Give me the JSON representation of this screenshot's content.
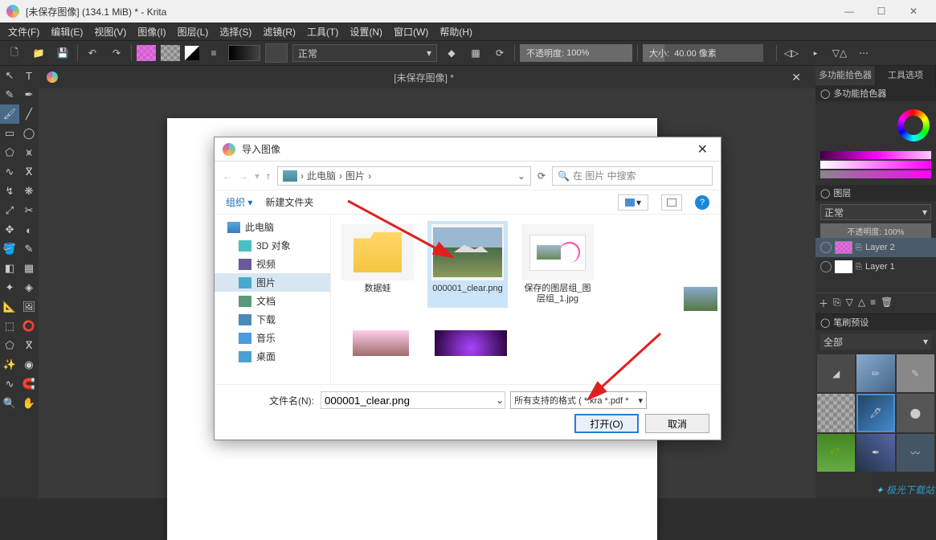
{
  "window": {
    "title": "[未保存图像]  (134.1 MiB)  * - Krita"
  },
  "menu": {
    "file": "文件(F)",
    "edit": "编辑(E)",
    "view": "视图(V)",
    "image": "图像(I)",
    "layer": "图层(L)",
    "select": "选择(S)",
    "filter": "滤镜(R)",
    "tools": "工具(T)",
    "settings": "设置(N)",
    "window": "窗口(W)",
    "help": "帮助(H)"
  },
  "toolbar": {
    "blend_mode": "正常",
    "opacity_label": "不透明度:",
    "opacity_value": "100%",
    "size_label": "大小:",
    "size_value": "40.00 像素"
  },
  "document": {
    "tab_title": "[未保存图像]  *"
  },
  "right": {
    "tab_color_picker": "多功能拾色器",
    "tab_tool_options": "工具选项",
    "header_picker": "多功能拾色器",
    "header_layers": "图层",
    "layer_blend": "正常",
    "layer_opacity": "不透明度: 100%",
    "layer2": "Layer 2",
    "layer1": "Layer 1",
    "header_brushes": "笔刷预设",
    "brush_filter": "全部"
  },
  "dialog": {
    "title": "导入图像",
    "path_thispc": "此电脑",
    "path_pictures": "图片",
    "search_placeholder": "在 图片 中搜索",
    "organize": "组织",
    "new_folder": "新建文件夹",
    "tree": {
      "thispc": "此电脑",
      "threed": "3D 对象",
      "video": "视频",
      "pictures": "图片",
      "docs": "文档",
      "downloads": "下载",
      "music": "音乐",
      "desktop": "桌面"
    },
    "files": {
      "folder1": "数据蛙",
      "img1": "000001_clear.png",
      "img2": "保存的图层组_图层组_1.jpg"
    },
    "filename_label": "文件名(N):",
    "filename_value": "000001_clear.png",
    "filter": "所有支持的格式 ( *.kra *.pdf *",
    "open": "打开(O)",
    "cancel": "取消"
  },
  "watermark": {
    "text": "极光下载站"
  }
}
